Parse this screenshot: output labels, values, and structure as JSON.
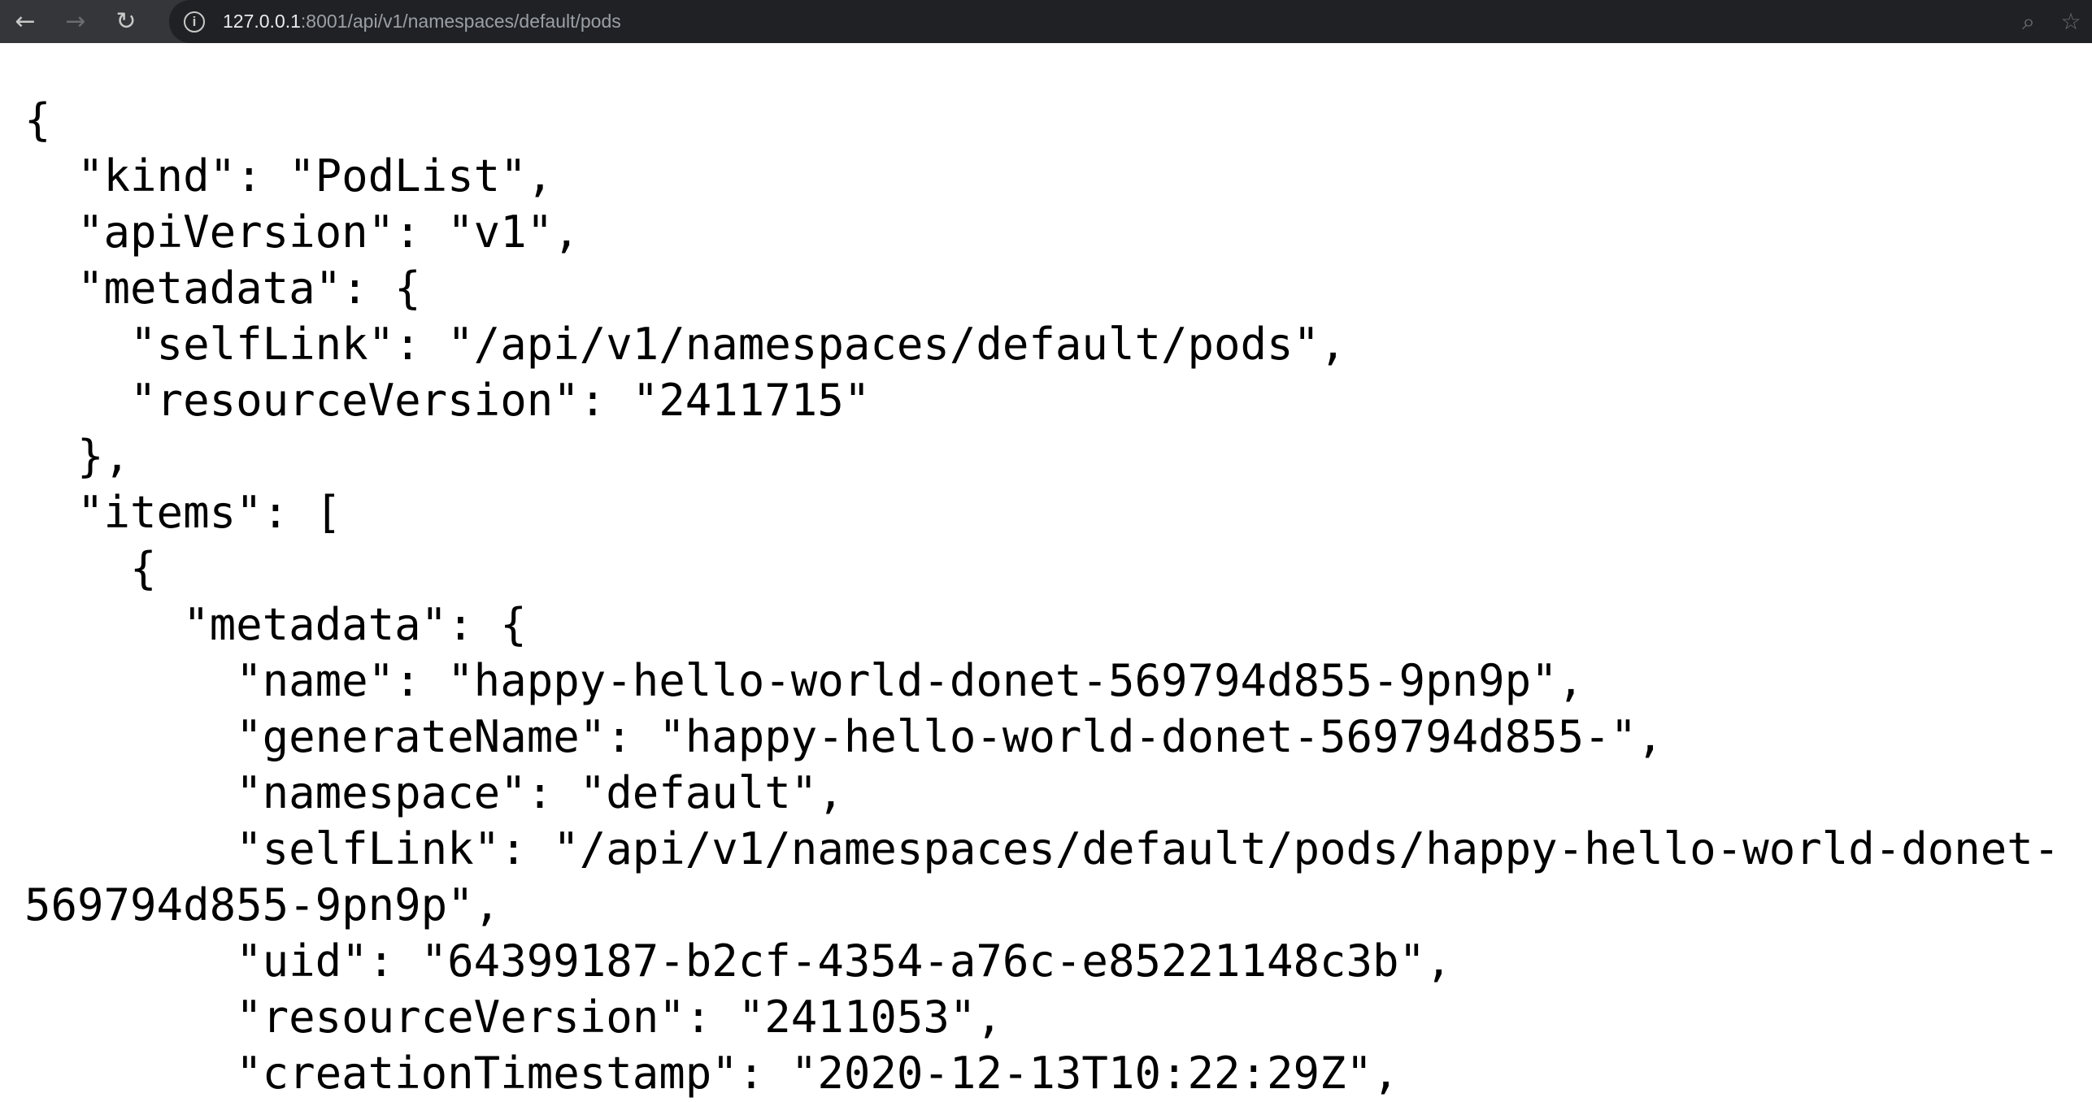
{
  "browser": {
    "back_label": "←",
    "forward_label": "→",
    "reload_label": "↻",
    "info_label": "i",
    "url_host": "127.0.0.1",
    "url_path": ":8001/api/v1/namespaces/default/pods",
    "zoom_label": "⌕",
    "bookmark_label": "☆"
  },
  "json_lines": [
    "{",
    "  \"kind\": \"PodList\",",
    "  \"apiVersion\": \"v1\",",
    "  \"metadata\": {",
    "    \"selfLink\": \"/api/v1/namespaces/default/pods\",",
    "    \"resourceVersion\": \"2411715\"",
    "  },",
    "  \"items\": [",
    "    {",
    "      \"metadata\": {",
    "        \"name\": \"happy-hello-world-donet-569794d855-9pn9p\",",
    "        \"generateName\": \"happy-hello-world-donet-569794d855-\",",
    "        \"namespace\": \"default\",",
    "        \"selfLink\": \"/api/v1/namespaces/default/pods/happy-hello-world-donet-",
    "569794d855-9pn9p\",",
    "        \"uid\": \"64399187-b2cf-4354-a76c-e85221148c3b\",",
    "        \"resourceVersion\": \"2411053\",",
    "        \"creationTimestamp\": \"2020-12-13T10:22:29Z\","
  ]
}
